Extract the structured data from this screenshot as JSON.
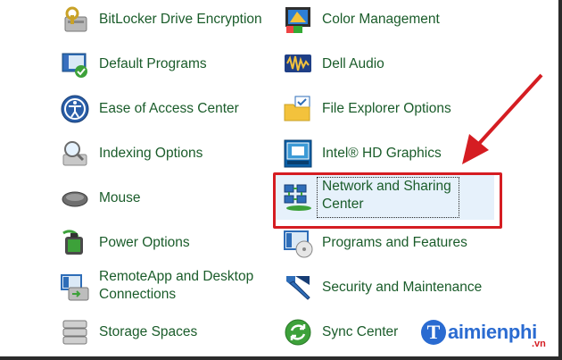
{
  "items": {
    "bitlocker": "BitLocker Drive Encryption",
    "color_management": "Color Management",
    "default_programs": "Default Programs",
    "dell_audio": "Dell Audio",
    "ease_of_access": "Ease of Access Center",
    "file_explorer": "File Explorer Options",
    "indexing": "Indexing Options",
    "intel_hd": "Intel® HD Graphics",
    "mouse": "Mouse",
    "network_line1": "Network and Sharing",
    "network_line2": "Center",
    "power": "Power Options",
    "programs_features": "Programs and Features",
    "remoteapp_line1": "RemoteApp and Desktop",
    "remoteapp_line2": "Connections",
    "security": "Security and Maintenance",
    "storage": "Storage Spaces",
    "sync": "Sync Center"
  },
  "watermark": {
    "mark": "T",
    "name": "aimienphi",
    "suffix": ".vn"
  },
  "colors": {
    "link_text": "#1a5c2a",
    "annotation_red": "#d51d22",
    "hover_bg": "#e6f1fb",
    "watermark_blue": "#2a6bd1"
  }
}
